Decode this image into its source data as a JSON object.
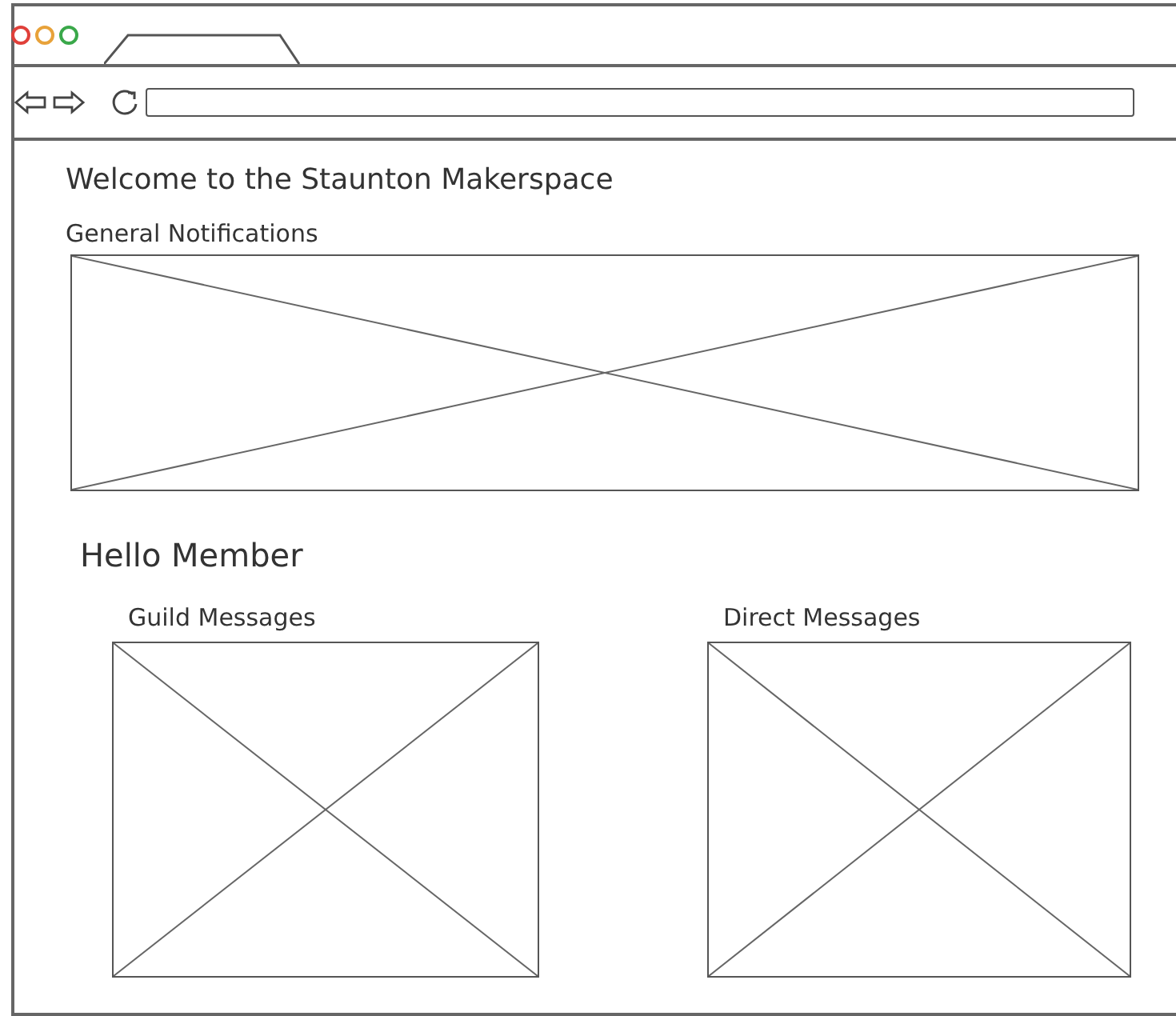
{
  "page": {
    "title": "Welcome to the Staunton Makerspace",
    "notifications": {
      "heading": "General Notifications"
    },
    "greeting": "Hello Member",
    "panels": [
      {
        "heading": "Guild Messages"
      },
      {
        "heading": "Direct Messages"
      }
    ]
  }
}
